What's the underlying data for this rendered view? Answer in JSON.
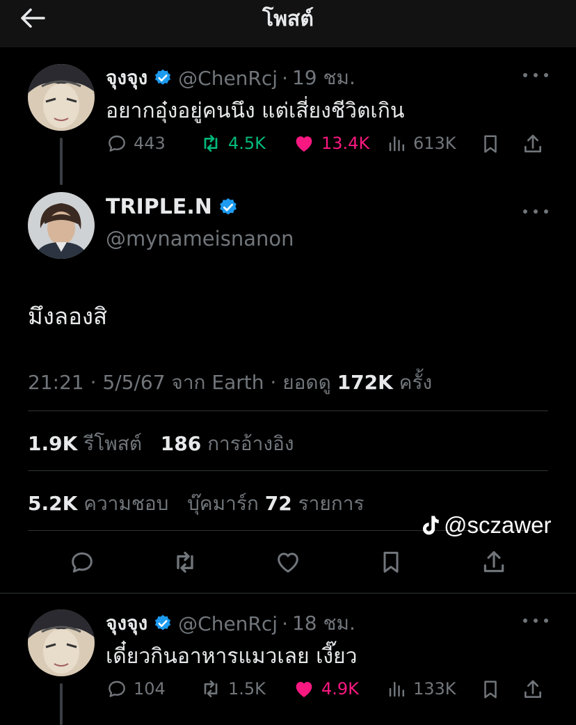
{
  "header": {
    "title": "โพสต์"
  },
  "reply_parent": {
    "name": "จุงจุง",
    "handle": "@ChenRcj",
    "time": "19 ชม.",
    "text": "อยากอุ๋งอยู่คนนึง แต่เสี่ยงชีวิตเกิน",
    "replies": "443",
    "reposts": "4.5K",
    "likes": "13.4K",
    "views": "613K"
  },
  "main_post": {
    "name": "TRIPLE.N",
    "handle": "@mynameisnanon",
    "text": "มึงลองสิ",
    "meta_time": "21:21 · 5/5/67 จาก Earth · ยอดดู",
    "meta_views": "172K",
    "meta_views_suffix": "ครั้ง",
    "reposts_count": "1.9K",
    "reposts_label": "รีโพสต์",
    "quotes_count": "186",
    "quotes_label": "การอ้างอิง",
    "likes_count": "5.2K",
    "likes_label": "ความชอบ",
    "bookmarks_label": "บุ๊คมาร์ก",
    "bookmarks_count": "72",
    "bookmarks_suffix": "รายการ"
  },
  "reply_child": {
    "name": "จุงจุง",
    "handle": "@ChenRcj",
    "time": "18 ชม.",
    "text": "เดี๋ยวกินอาหารแมวเลย เงี๊ยว",
    "replies": "104",
    "reposts": "1.5K",
    "likes": "4.9K",
    "views": "133K"
  },
  "watermark": {
    "text": "@sczawer"
  },
  "colors": {
    "verified": "#1d9bf0",
    "repost": "#00ba7c",
    "like": "#f91880",
    "muted": "#71767b"
  }
}
